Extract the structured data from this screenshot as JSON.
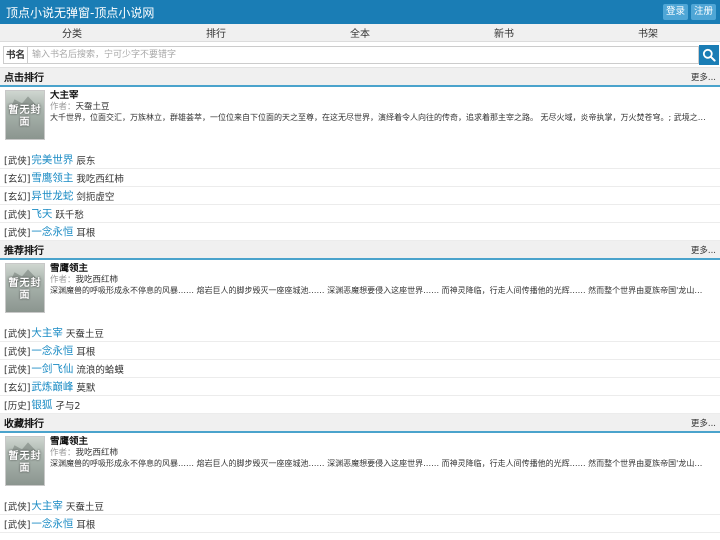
{
  "header": {
    "title": "顶点小说无弹窗-顶点小说网",
    "login": "登录",
    "register": "注册"
  },
  "nav": [
    "分类",
    "排行",
    "全本",
    "新书",
    "书架"
  ],
  "search": {
    "label": "书名",
    "placeholder": "输入书名后搜索，宁可少字不要错字"
  },
  "more_label": "更多...",
  "author_label": "作者：",
  "cover_text": "暂无封面",
  "sections": [
    {
      "title": "点击排行",
      "feature": {
        "title": "大主宰",
        "author": "天蚕土豆",
        "desc": "大千世界，位面交汇，万族林立，群雄荟萃，一位位来自下位面的天之至尊，在这无尽世界，演绎着令人向往的传奇，追求着那主宰之路。 无尽火域，炎帝执掌，万火焚苍穹。; 武境之内，武祖之威，震慑乾坤。 ..."
      },
      "items": [
        {
          "genre": "[武侠]",
          "title": "完美世界",
          "author": "辰东"
        },
        {
          "genre": "[玄幻]",
          "title": "雪鹰领主",
          "author": "我吃西红柿"
        },
        {
          "genre": "[玄幻]",
          "title": "异世龙蛇",
          "author": "剑扼虚空"
        },
        {
          "genre": "[武侠]",
          "title": "飞天",
          "author": "跃千愁"
        },
        {
          "genre": "[武侠]",
          "title": "一念永恒",
          "author": "耳根"
        }
      ]
    },
    {
      "title": "推荐排行",
      "feature": {
        "title": "雪鹰领主",
        "author": "我吃西红柿",
        "desc": "深渊魔兽的呼吸形成永不停息的风暴…… 熔岩巨人的脚步毁灭一座座城池…… 深渊恶魔想要侵入这座世界…… 而神灵降临，行走人间传播他的光辉…… 然而整个世界由夏族帝国'龙山帝国'统治，..."
      },
      "items": [
        {
          "genre": "[武侠]",
          "title": "大主宰",
          "author": "天蚕土豆"
        },
        {
          "genre": "[武侠]",
          "title": "一念永恒",
          "author": "耳根"
        },
        {
          "genre": "[武侠]",
          "title": "一剑飞仙",
          "author": "流浪的蛤蟆"
        },
        {
          "genre": "[玄幻]",
          "title": "武炼巅峰",
          "author": "莫默"
        },
        {
          "genre": "[历史]",
          "title": "银狐",
          "author": "孑与2"
        }
      ]
    },
    {
      "title": "收藏排行",
      "feature": {
        "title": "雪鹰领主",
        "author": "我吃西红柿",
        "desc": "深渊魔兽的呼吸形成永不停息的风暴…… 熔岩巨人的脚步毁灭一座座城池…… 深渊恶魔想要侵入这座世界…… 而神灵降临，行走人间传播他的光辉…… 然而整个世界由夏族帝国'龙山帝国'统治，..."
      },
      "items": [
        {
          "genre": "[武侠]",
          "title": "大主宰",
          "author": "天蚕土豆"
        },
        {
          "genre": "[武侠]",
          "title": "一念永恒",
          "author": "耳根"
        }
      ]
    }
  ]
}
